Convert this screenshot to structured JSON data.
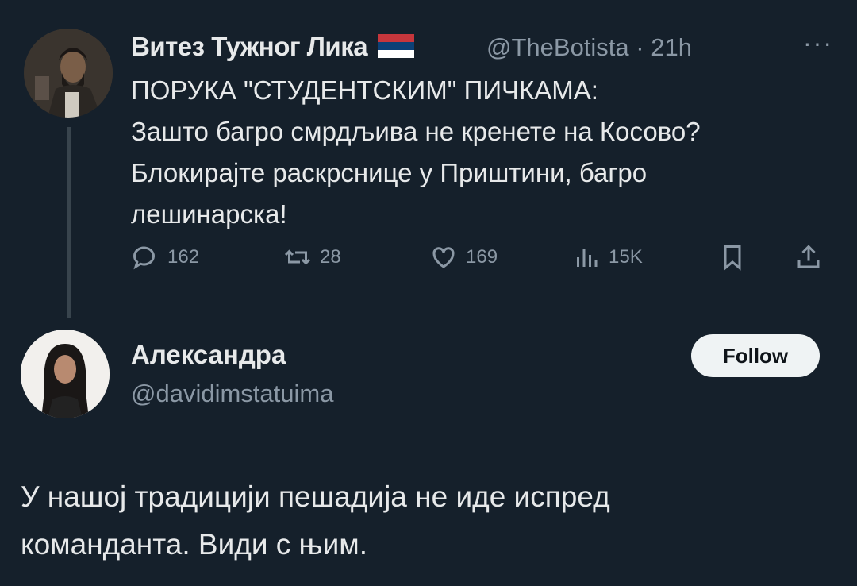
{
  "tweet1": {
    "author_name": "Витез Тужног Лика",
    "handle_time": "@TheBotista · 21h",
    "more": "···",
    "text": "ПОРУКА \"СТУДЕНТСКИМ\" ПИЧКАМА:\nЗашто багро смрдљива не кренете на Косово?\nБлокирајте раскрснице у Приштини, багро\nлешинарска!",
    "actions": {
      "replies": "162",
      "reposts": "28",
      "likes": "169",
      "views": "15K"
    }
  },
  "tweet2": {
    "author_name": "Александра",
    "handle": "@davidimstatuima",
    "follow_label": "Follow",
    "text": "У нашој традицији пешадија не иде испред\nкоманданта. Види с њим."
  },
  "colors": {
    "background": "#15202b",
    "text": "#e7e9ea",
    "muted": "#8b98a5",
    "thread_line": "#38444d",
    "flag_red": "#c6363c",
    "flag_blue": "#0c4076",
    "flag_white": "#ffffff"
  },
  "icons": [
    "reply-icon",
    "repost-icon",
    "like-icon",
    "views-icon",
    "bookmark-icon",
    "share-icon",
    "serbian-flag-icon"
  ]
}
